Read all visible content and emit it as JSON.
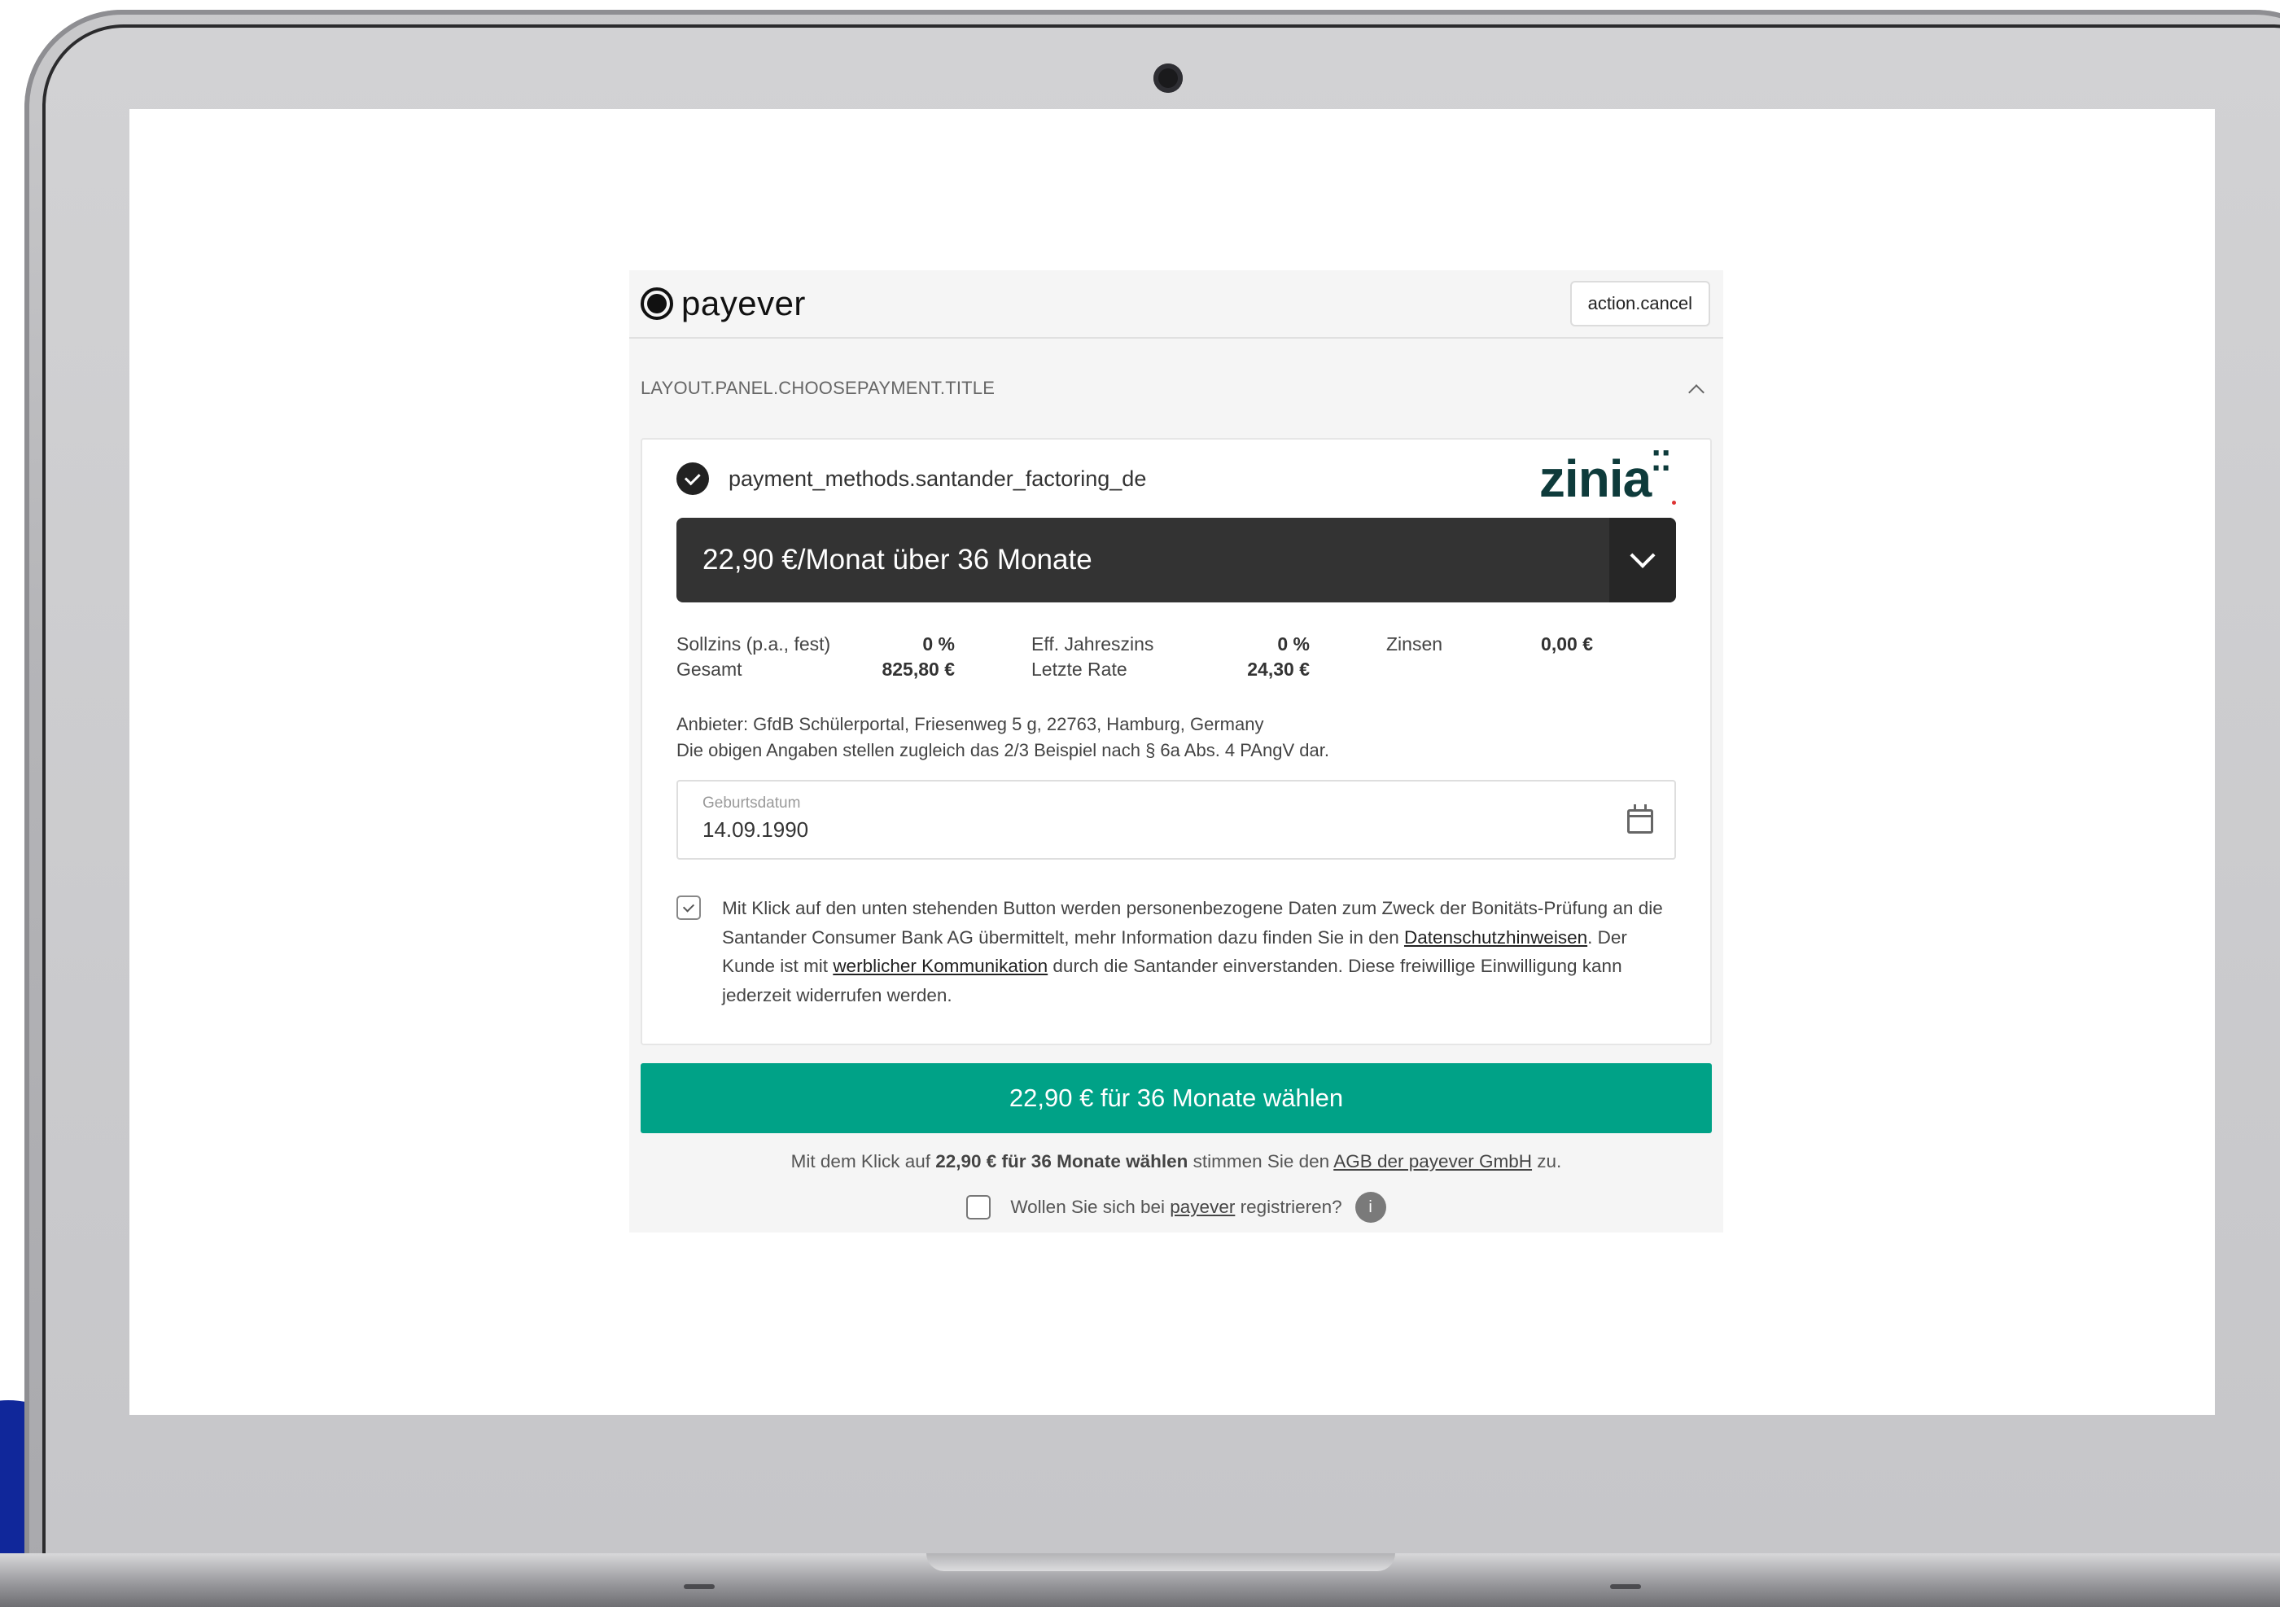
{
  "header": {
    "brand": "payever",
    "cancel_label": "action.cancel"
  },
  "section": {
    "title": "LAYOUT.PANEL.CHOOSEPAYMENT.TITLE"
  },
  "payment_method": {
    "name": "payment_methods.santander_factoring_de",
    "partner_logo_text": "zinia",
    "plan_selected": "22,90 €/Monat über 36 Monate"
  },
  "terms": {
    "sollzins_label": "Sollzins (p.a., fest)",
    "sollzins_value": "0 %",
    "eff_label": "Eff. Jahreszins",
    "eff_value": "0 %",
    "zinsen_label": "Zinsen",
    "zinsen_value": "0,00 €",
    "gesamt_label": "Gesamt",
    "gesamt_value": "825,80 €",
    "letzte_label": "Letzte Rate",
    "letzte_value": "24,30 €"
  },
  "provider": {
    "line1": "Anbieter: GfdB Schülerportal, Friesenweg 5 g, 22763, Hamburg, Germany",
    "line2": "Die obigen Angaben stellen zugleich das 2/3 Beispiel nach § 6a Abs. 4 PAngV dar."
  },
  "birthdate": {
    "label": "Geburtsdatum",
    "value": "14.09.1990"
  },
  "consent": {
    "checked": true,
    "text1": "Mit Klick auf den unten stehenden Button werden personenbezogene Daten zum Zweck der Bonitäts-Prüfung an die Santander Consumer Bank AG übermittelt, mehr Information dazu finden Sie in den ",
    "link1": "Datenschutzhinweisen",
    "text2": ". Der Kunde ist mit ",
    "link2": "werblicher Kommunikation",
    "text3": " durch die Santander einverstanden. Diese freiwillige Einwilligung kann jederzeit widerrufen werden."
  },
  "cta": {
    "label": "22,90 € für 36 Monate wählen"
  },
  "agreement": {
    "prefix": "Mit dem Klick auf ",
    "bold": "22,90 € für 36 Monate wählen",
    "middle": " stimmen Sie den ",
    "link": "AGB der payever GmbH",
    "suffix": " zu."
  },
  "register": {
    "prefix": "Wollen Sie sich bei ",
    "link": "payever",
    "suffix": " registrieren?",
    "info_glyph": "i"
  },
  "icons": {
    "brand": "payever-logo-icon",
    "collapse": "chevron-up-icon",
    "selected": "check-circle-icon",
    "dropdown": "chevron-down-icon",
    "calendar": "calendar-icon",
    "info": "info-icon"
  },
  "colors": {
    "accent": "#00a287",
    "select_bg": "#333333",
    "zinia": "#0e3b3b"
  }
}
